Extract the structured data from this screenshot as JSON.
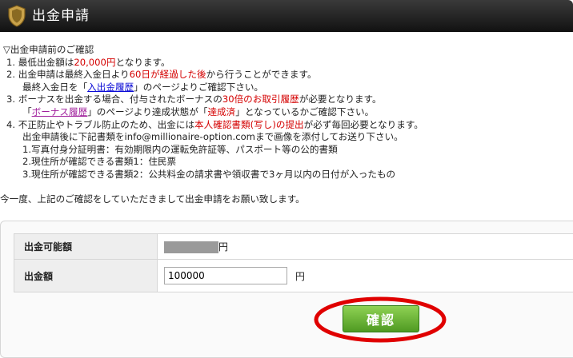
{
  "header": {
    "title": "出金申請",
    "icon": "shield-icon"
  },
  "notice": {
    "heading": "▽出金申請前のご確認",
    "item1": {
      "num": "1.",
      "pre": "最低出金額は",
      "amount": "20,000円",
      "post": "となります。"
    },
    "item2": {
      "num": "2.",
      "pre": "出金申請は最終入金日より",
      "days": "60日が経過した後",
      "post": "から行うことができます。",
      "sub_pre": "最終入金日を「",
      "sub_link": "入出金履歴",
      "sub_post": "」のページよりご確認下さい。"
    },
    "item3": {
      "num": "3.",
      "pre": "ボーナスを出金する場合、付与されたボーナスの",
      "emph": "30倍のお取引履歴",
      "post": "が必要となります。",
      "sub_pre": "「",
      "sub_link": "ボーナス履歴",
      "sub_mid": "」のページより達成状態が「",
      "sub_emph": "達成済",
      "sub_post": "」となっているかご確認下さい。"
    },
    "item4": {
      "num": "4.",
      "pre": "不正防止やトラブル防止のため、出金には",
      "emph": "本人確認書類(写し)の提出",
      "post": "が必ず毎回必要となります。",
      "sub1": "出金申請後に下記書類をinfo@millionaire-option.comまで画像を添付してお送り下さい。",
      "sub2": "1.写真付身分証明書：有効期限内の運転免許証等、パスポート等の公的書類",
      "sub3": "2.現住所が確認できる書類1：住民票",
      "sub4": "3.現住所が確認できる書類2：公共料金の請求書や領収書で3ヶ月以内の日付が入ったもの"
    },
    "final": "今一度、上記のご確認をしていただきまして出金申請をお願い致します。"
  },
  "form": {
    "available_label": "出金可能額",
    "available_unit": "円",
    "amount_label": "出金額",
    "amount_value": "100000",
    "amount_unit": "円",
    "confirm_label": "確認"
  },
  "colors": {
    "emphasis": "#d40000",
    "link": "#0a0ad6",
    "visited_link": "#a0209c",
    "button": "#4f9a22",
    "highlight": "#e00000"
  }
}
